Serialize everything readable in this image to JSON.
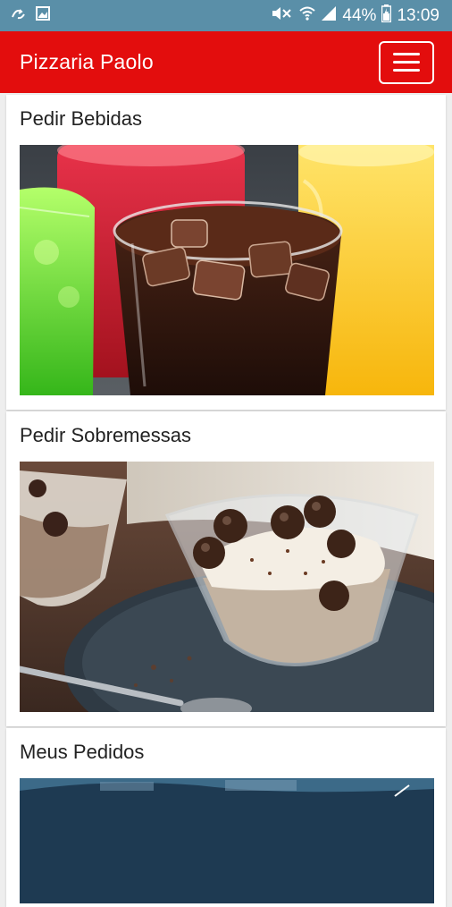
{
  "status_bar": {
    "battery": "44%",
    "time": "13:09"
  },
  "app_bar": {
    "title": "Pizzaria Paolo",
    "menu_icon": "hamburger-menu-icon"
  },
  "cards": [
    {
      "title": "Pedir Bebidas",
      "image": "soft-drinks-glasses"
    },
    {
      "title": "Pedir Sobremessas",
      "image": "tiramisu-dessert-glasses"
    },
    {
      "title": "Meus Pedidos",
      "image": "orders-photo"
    }
  ],
  "colors": {
    "status_bar": "#5a8fa8",
    "app_bar": "#e30d0d",
    "background": "#eeeeee"
  }
}
